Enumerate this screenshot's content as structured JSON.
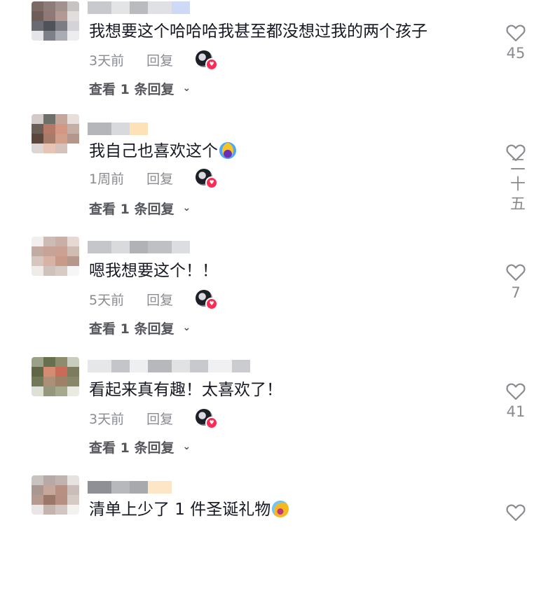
{
  "comments": [
    {
      "text": "我想要这个哈哈哈我甚至都没想过我的两个孩子",
      "time": "3天前",
      "reply_label": "回复",
      "view_replies": "查看 1 条回复",
      "likes": "45",
      "avatar_colors": [
        "#7b6a66",
        "#8d7c79",
        "#a2928f",
        "#c7c3c2",
        "#6f5d59",
        "#8e7974",
        "#b29a93",
        "#e1dddc",
        "#6a6a72",
        "#4f5258",
        "#7c7c84",
        "#d3d3d8",
        "#e5e5e8",
        "#7d8088",
        "#a9acb2",
        "#ededf0"
      ],
      "username_colors": [
        "#c8c9cd",
        "#e3e4e6",
        "#b9bbbf",
        "#e0e1e4",
        "#cdd9f5"
      ]
    },
    {
      "text": "我自己也喜欢这个",
      "emoji": "crying-face-emoji",
      "time": "1周前",
      "reply_label": "回复",
      "view_replies": "查看 1 条回复",
      "likes": "二十五",
      "avatar_colors": [
        "#d4cbc8",
        "#6e6e6a",
        "#c4a79a",
        "#e8dedb",
        "#6a5f57",
        "#b47a66",
        "#d39783",
        "#c5aea4",
        "#5b463e",
        "#a77b6a",
        "#d2a08a",
        "#b4968a",
        "#dcd7d5",
        "#e8c4b4",
        "#d4c3bc",
        "#ffffff"
      ],
      "username_colors": [
        "#b5b6ba",
        "#d8d9dc",
        "#fde1b7"
      ]
    },
    {
      "text": "嗯我想要这个！！",
      "time": "5天前",
      "reply_label": "回复",
      "view_replies": "查看 1 条回复",
      "likes": "7",
      "avatar_colors": [
        "#f2efee",
        "#cdbbb6",
        "#c9afa5",
        "#e6d9d4",
        "#c4aba2",
        "#c7a296",
        "#caa193",
        "#d1bcb4",
        "#d7c6c0",
        "#d8b2a5",
        "#c99a88",
        "#b6978c",
        "#efebe9",
        "#cfc2bd",
        "#d8cbc6",
        "#f7f6f6"
      ],
      "username_colors": [
        "#c5c6ca",
        "#d9dadc",
        "#b1b2b6",
        "#bfc0c3",
        "#dcdde0"
      ]
    },
    {
      "text": "看起来真有趣！太喜欢了！",
      "time": "3天前",
      "reply_label": "回复",
      "view_replies": "查看 1 条回复",
      "likes": "41",
      "avatar_colors": [
        "#9aa186",
        "#67704e",
        "#8d8c6c",
        "#c9cdbd",
        "#5f6746",
        "#d38b72",
        "#c96b58",
        "#7d7c5e",
        "#717a58",
        "#ad8f77",
        "#9d8268",
        "#888769",
        "#dde0d5",
        "#95987d",
        "#a7a98f",
        "#e9ebe2"
      ],
      "username_colors": [
        "#e6e7e9",
        "#c4c5c9",
        "#eeeff1",
        "#b7b8bc",
        "#e1e2e4",
        "#c8c9cc",
        "#f0f0f2",
        "#cbccd0"
      ]
    },
    {
      "text": "清单上少了 1 件圣诞礼物",
      "emoji": "laughing-face-emoji",
      "avatar_colors": [
        "#c9c3c0",
        "#b7aaa6",
        "#c1b4af",
        "#e6e2e0",
        "#a99891",
        "#c7a79a",
        "#b98f81",
        "#cbbdb7",
        "#b79a8f",
        "#9b776a",
        "#b68f82",
        "#d6cac5",
        "#e9e6e5",
        "#c3b4ae",
        "#d1c6c2",
        "#f4f2f1"
      ],
      "username_colors": [
        "#8f9095",
        "#b7b8bc",
        "#a8a9ad",
        "#fde6c5"
      ]
    }
  ],
  "colors": {
    "heart_outline": "#8a8b91",
    "badge": "#fe2c55",
    "meta_text": "#8a8b91"
  }
}
